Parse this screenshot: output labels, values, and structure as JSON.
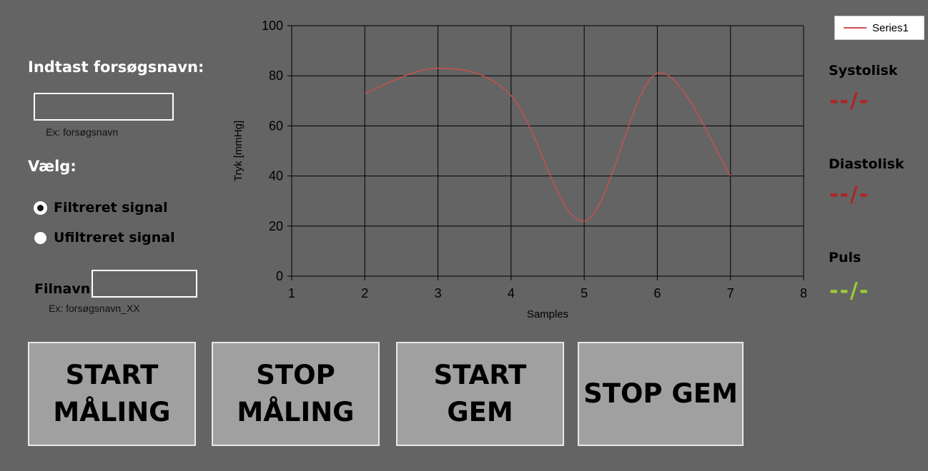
{
  "form": {
    "name_heading": "Indtast forsøgsnavn:",
    "name_value": "",
    "name_hint": "Ex: forsøgsnavn",
    "choose_heading": "Vælg:",
    "radio_filtered": "Filtreret signal",
    "radio_unfiltered": "Ufiltreret signal",
    "selected": "filtered",
    "filename_label": "Filnavn:",
    "filename_value": "",
    "filename_hint": "Ex: forsøgsnavn_XX"
  },
  "buttons": {
    "start_measure": "START\nMÅLING",
    "stop_measure": "STOP\nMÅLING",
    "start_save": "START\nGEM",
    "stop_save": "STOP GEM"
  },
  "readouts": {
    "systolic_label": "Systolisk",
    "systolic_value": "--/-",
    "systolic_color": "#b22222",
    "diastolic_label": "Diastolisk",
    "diastolic_value": "--/-",
    "diastolic_color": "#b22222",
    "pulse_label": "Puls",
    "pulse_value": "--/-",
    "pulse_color": "#9acd32"
  },
  "chart_data": {
    "type": "line",
    "title": "",
    "xlabel": "Samples",
    "ylabel": "Tryk [mmHg]",
    "xlim": [
      1,
      8
    ],
    "ylim": [
      0,
      100
    ],
    "xticks": [
      1,
      2,
      3,
      4,
      5,
      6,
      7,
      8
    ],
    "yticks": [
      0,
      20,
      40,
      60,
      80,
      100
    ],
    "grid": true,
    "legend_position": "top-right",
    "series": [
      {
        "name": "Series1",
        "color": "#c85050",
        "smooth": true,
        "x": [
          2,
          3,
          4,
          5,
          6,
          7
        ],
        "y": [
          73,
          83,
          72,
          22,
          81,
          40
        ]
      }
    ]
  }
}
